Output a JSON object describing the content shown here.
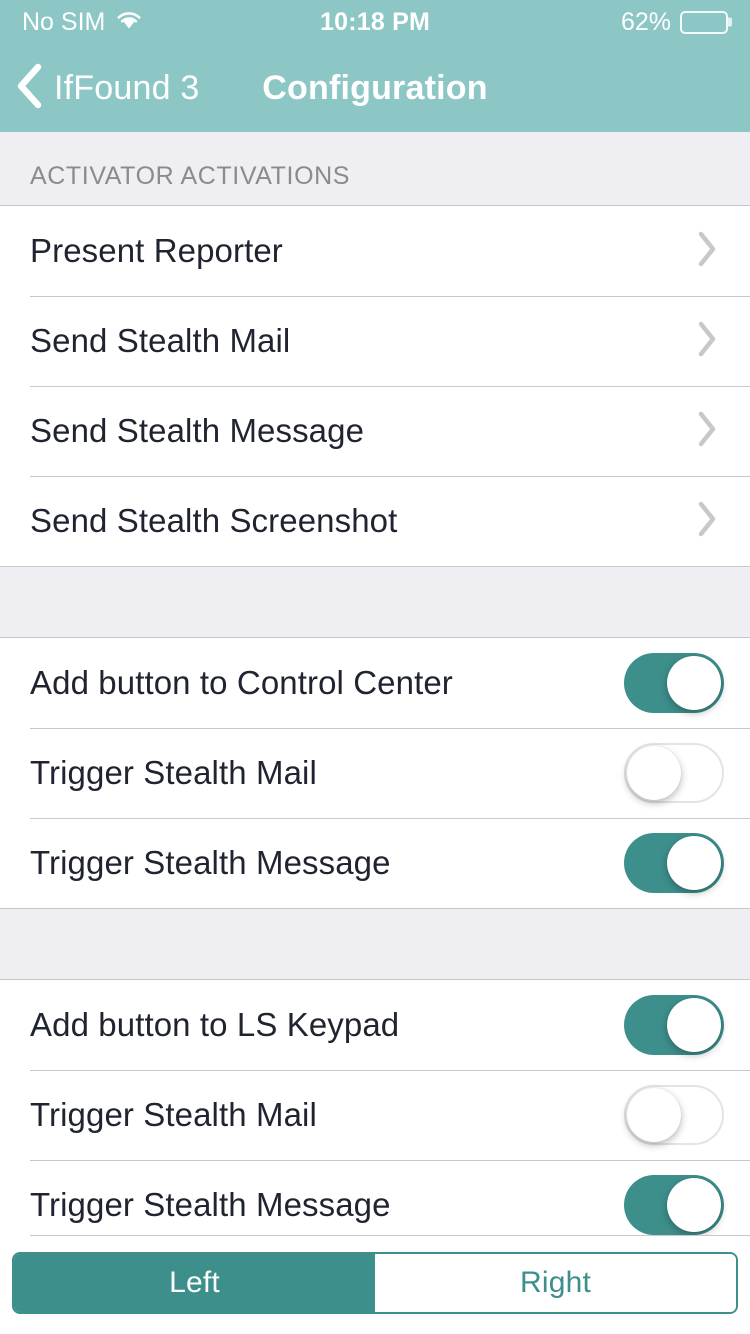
{
  "status_bar": {
    "carrier": "No SIM",
    "wifi_icon": "wifi-icon",
    "time": "10:18 PM",
    "battery_percent": "62%",
    "battery_level": 62,
    "battery_fill_color": "#FFCC00"
  },
  "nav": {
    "back_icon": "chevron-left-icon",
    "back_label": "IfFound 3",
    "title": "Configuration",
    "bar_color": "#8CC7C5"
  },
  "theme": {
    "accent": "#3D8F8C",
    "nav_bar": "#8CC7C5",
    "group_background": "#EFEEF3",
    "row_background": "#FFFFFF",
    "separator": "#C8C7CC",
    "row_text": "#1F2430",
    "header_text": "#8A8A8F"
  },
  "sections": [
    {
      "header": "ACTIVATOR ACTIVATIONS",
      "rows": [
        {
          "label": "Present Reporter",
          "type": "disclosure",
          "icon": "chevron-right-icon"
        },
        {
          "label": "Send Stealth Mail",
          "type": "disclosure",
          "icon": "chevron-right-icon"
        },
        {
          "label": "Send Stealth Message",
          "type": "disclosure",
          "icon": "chevron-right-icon"
        },
        {
          "label": "Send Stealth Screenshot",
          "type": "disclosure",
          "icon": "chevron-right-icon"
        }
      ]
    },
    {
      "header": "",
      "rows": [
        {
          "label": "Add button to Control Center",
          "type": "toggle",
          "value": "on"
        },
        {
          "label": "Trigger Stealth Mail",
          "type": "toggle",
          "value": "off"
        },
        {
          "label": "Trigger Stealth Message",
          "type": "toggle",
          "value": "on"
        }
      ]
    },
    {
      "header": "",
      "rows": [
        {
          "label": "Add button to LS Keypad",
          "type": "toggle",
          "value": "on"
        },
        {
          "label": "Trigger Stealth Mail",
          "type": "toggle",
          "value": "off"
        },
        {
          "label": "Trigger Stealth Message",
          "type": "toggle",
          "value": "on"
        }
      ]
    }
  ],
  "segmented_control": {
    "options": [
      {
        "label": "Left",
        "selected": true
      },
      {
        "label": "Right",
        "selected": false
      }
    ]
  }
}
